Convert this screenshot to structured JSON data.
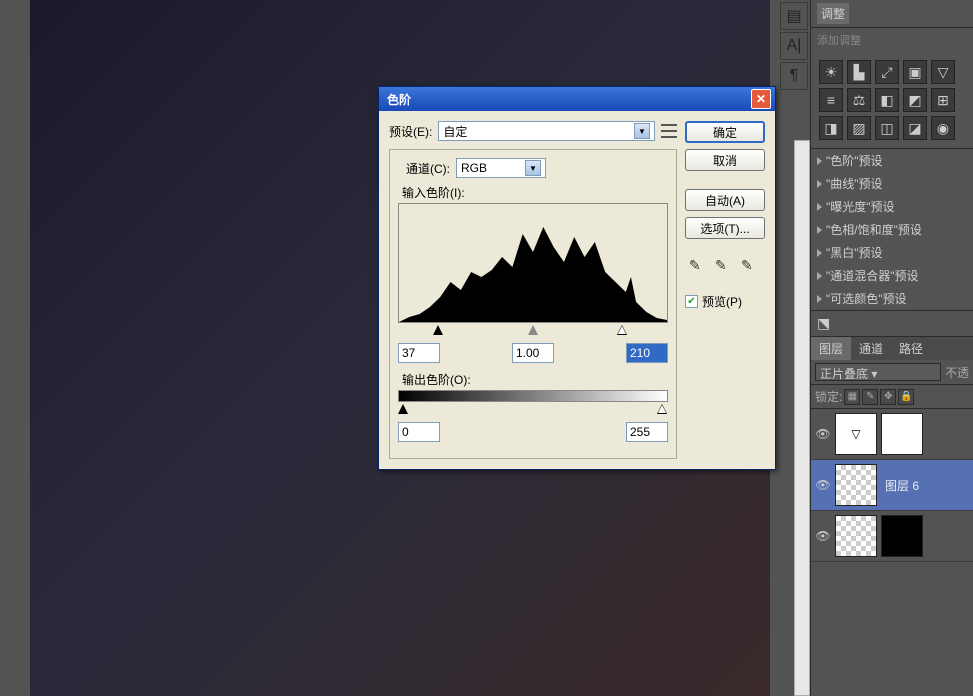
{
  "canvas": {},
  "right_panel": {
    "adjustments_tab": "调整",
    "add_adjustment": "添加调整",
    "presets": [
      "\"色阶\"预设",
      "\"曲线\"预设",
      "\"曝光度\"预设",
      "\"色相/饱和度\"预设",
      "\"黑白\"预设",
      "\"通道混合器\"预设",
      "\"可选颜色\"预设"
    ]
  },
  "layers_panel": {
    "tabs": {
      "layers": "图层",
      "channels": "通道",
      "paths": "路径"
    },
    "blend_mode": "正片叠底",
    "opacity_label": "不透",
    "lock_label": "锁定:",
    "layers": [
      {
        "name": ""
      },
      {
        "name": "图层 6",
        "selected": true
      },
      {
        "name": ""
      }
    ]
  },
  "dialog": {
    "title": "色阶",
    "preset_label": "预设(E):",
    "preset_value": "自定",
    "channel_label": "通道(C):",
    "channel_value": "RGB",
    "input_levels_label": "输入色阶(I):",
    "output_levels_label": "输出色阶(O):",
    "shadow": "37",
    "mid": "1.00",
    "highlight": "210",
    "out_black": "0",
    "out_white": "255",
    "buttons": {
      "ok": "确定",
      "cancel": "取消",
      "auto": "自动(A)",
      "options": "选项(T)..."
    },
    "preview_label": "预览(P)"
  }
}
